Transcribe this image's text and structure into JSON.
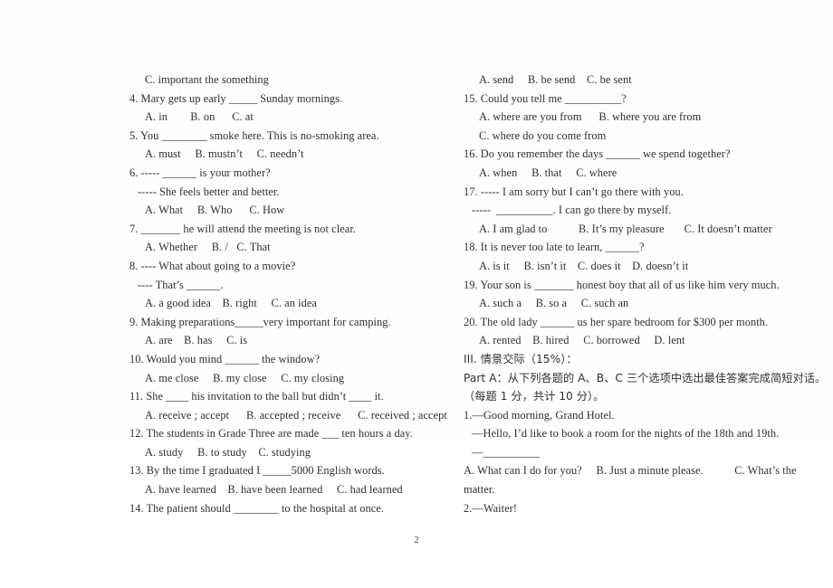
{
  "document": {
    "page_number": "2",
    "background_color": "#ffffff",
    "text_color": "#2f2f2f"
  },
  "left_column": {
    "lines": [
      {
        "text": "C. important the something",
        "indent": 1
      },
      {
        "text": "4. Mary gets up early _____ Sunday mornings.",
        "indent": 0
      },
      {
        "text": "A. in        B. on      C. at",
        "indent": 1
      },
      {
        "text": "5. You ________ smoke here. This is no-smoking area.",
        "indent": 0
      },
      {
        "text": "A. must     B. mustn’t     C. needn’t",
        "indent": 1
      },
      {
        "text": "6. ----- ______ is your mother?",
        "indent": 0
      },
      {
        "text": "----- She feels better and better.",
        "indent": 2
      },
      {
        "text": "A. What     B. Who      C. How",
        "indent": 1
      },
      {
        "text": "7. _______ he will attend the meeting is not clear.",
        "indent": 0
      },
      {
        "text": "A. Whether     B. /   C. That",
        "indent": 1
      },
      {
        "text": "8. ---- What about going to a movie?",
        "indent": 0
      },
      {
        "text": "---- That’s ______.",
        "indent": 2
      },
      {
        "text": "A. a good idea    B. right     C. an idea",
        "indent": 1
      },
      {
        "text": "9. Making preparations_____very important for camping.",
        "indent": 0
      },
      {
        "text": "A. are    B. has     C. is",
        "indent": 1
      },
      {
        "text": "10. Would you mind ______ the window?",
        "indent": 0
      },
      {
        "text": "A. me close     B. my close     C. my closing",
        "indent": 1
      },
      {
        "text": "11. She ____ his invitation to the ball but didn’t ____ it.",
        "indent": 0
      },
      {
        "text": "A. receive ; accept      B. accepted ; receive      C. received ; accept",
        "indent": 1
      },
      {
        "text": "12. The students in Grade Three are made ___ ten hours a day.",
        "indent": 0
      },
      {
        "text": "A. study     B. to study    C. studying",
        "indent": 1
      },
      {
        "text": "13. By the time I graduated I _____5000 English words.",
        "indent": 0
      },
      {
        "text": "A. have learned    B. have been learned     C. had learned",
        "indent": 1
      },
      {
        "text": "14. The patient should ________ to the hospital at once.",
        "indent": 0
      }
    ]
  },
  "right_column": {
    "lines": [
      {
        "text": "A. send     B. be send    C. be sent",
        "indent": 1,
        "cjk": false
      },
      {
        "text": "15. Could you tell me __________?",
        "indent": 0,
        "cjk": false
      },
      {
        "text": "A. where are you from      B. where you are from",
        "indent": 1,
        "cjk": false
      },
      {
        "text": "C. where do you come from",
        "indent": 1,
        "cjk": false
      },
      {
        "text": "16. Do you remember the days ______ we spend together?",
        "indent": 0,
        "cjk": false
      },
      {
        "text": "A. when     B. that     C. where",
        "indent": 1,
        "cjk": false
      },
      {
        "text": "17. ----- I am sorry but I can’t go there with you.",
        "indent": 0,
        "cjk": false
      },
      {
        "text": "-----  __________. I can go there by myself.",
        "indent": 2,
        "cjk": false
      },
      {
        "text": "A. I am glad to           B. It’s my pleasure       C. It doesn’t matter",
        "indent": 1,
        "cjk": false
      },
      {
        "text": "18. It is never too late to learn, ______?",
        "indent": 0,
        "cjk": false
      },
      {
        "text": "A. is it     B. isn’t it    C. does it    D. doesn’t it",
        "indent": 1,
        "cjk": false
      },
      {
        "text": "19. Your son is _______ honest boy that all of us like him very much.",
        "indent": 0,
        "cjk": false
      },
      {
        "text": "A. such a     B. so a     C. such an",
        "indent": 1,
        "cjk": false
      },
      {
        "text": "20. The old lady ______ us her spare bedroom for $300 per month.",
        "indent": 0,
        "cjk": false
      },
      {
        "text": "A. rented    B. hired     C. borrowed     D. lent",
        "indent": 1,
        "cjk": false
      },
      {
        "text": "III. 情景交际（15%）：",
        "indent": 0,
        "cjk": true
      },
      {
        "text": "Part A：从下列各题的 A、B、C 三个选项中选出最佳答案完成简短对话。",
        "indent": 0,
        "cjk": true
      },
      {
        "text": "（每题 1 分，共计 10 分）。",
        "indent": 0,
        "cjk": true
      },
      {
        "text": "1.—Good morning, Grand Hotel.",
        "indent": 0,
        "cjk": false
      },
      {
        "text": "—Hello, I’d like to book a room for the nights of the 18th and 19th.",
        "indent": 2,
        "cjk": false
      },
      {
        "text": "—__________",
        "indent": 2,
        "cjk": false
      },
      {
        "text": "A. What can I do for you?     B. Just a minute please.           C. What’s the",
        "indent": 0,
        "cjk": false
      },
      {
        "text": "matter.",
        "indent": 0,
        "cjk": false
      },
      {
        "text": "2.—Waiter!",
        "indent": 0,
        "cjk": false
      }
    ]
  }
}
